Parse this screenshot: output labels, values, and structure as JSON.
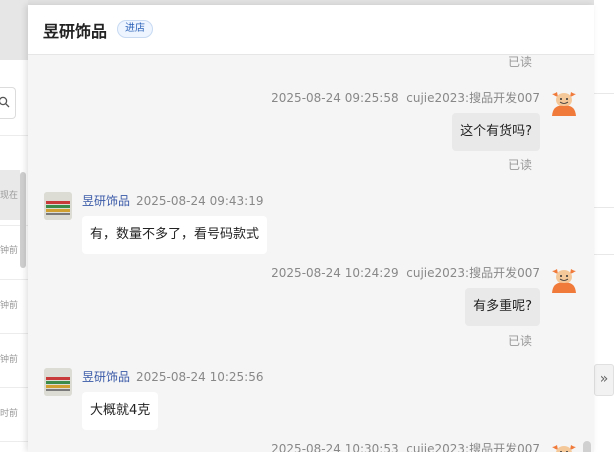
{
  "header": {
    "shop_name": "昱研饰品",
    "enter_label": "进店"
  },
  "sidebar_fragments": [
    "现在",
    "钟前",
    "钟前",
    "钟前",
    "时前"
  ],
  "messages": [
    {
      "read": "已读"
    },
    {
      "sender": "cujie2023:搜品开发007",
      "time": "2025-08-24 09:25:58",
      "text": "这个有货吗?",
      "read": "已读"
    },
    {
      "sender": "昱研饰品",
      "time": "2025-08-24 09:43:19",
      "text": "有，数量不多了，看号码款式"
    },
    {
      "sender": "cujie2023:搜品开发007",
      "time": "2025-08-24 10:24:29",
      "text": "有多重呢?",
      "read": "已读"
    },
    {
      "sender": "昱研饰品",
      "time": "2025-08-24 10:25:56",
      "text": "大概就4克"
    },
    {
      "sender": "cujie2023:搜品开发007",
      "time": "2025-08-24 10:30:53"
    }
  ],
  "colors": {
    "accent": "#2b62b8",
    "shop_name_link": "#3a5aa8",
    "avatar_orange": "#f07a3a"
  },
  "icons": {
    "search": "search-icon",
    "expand": "double-chevron-right-icon",
    "user_avatar": "ox-avatar-icon"
  }
}
